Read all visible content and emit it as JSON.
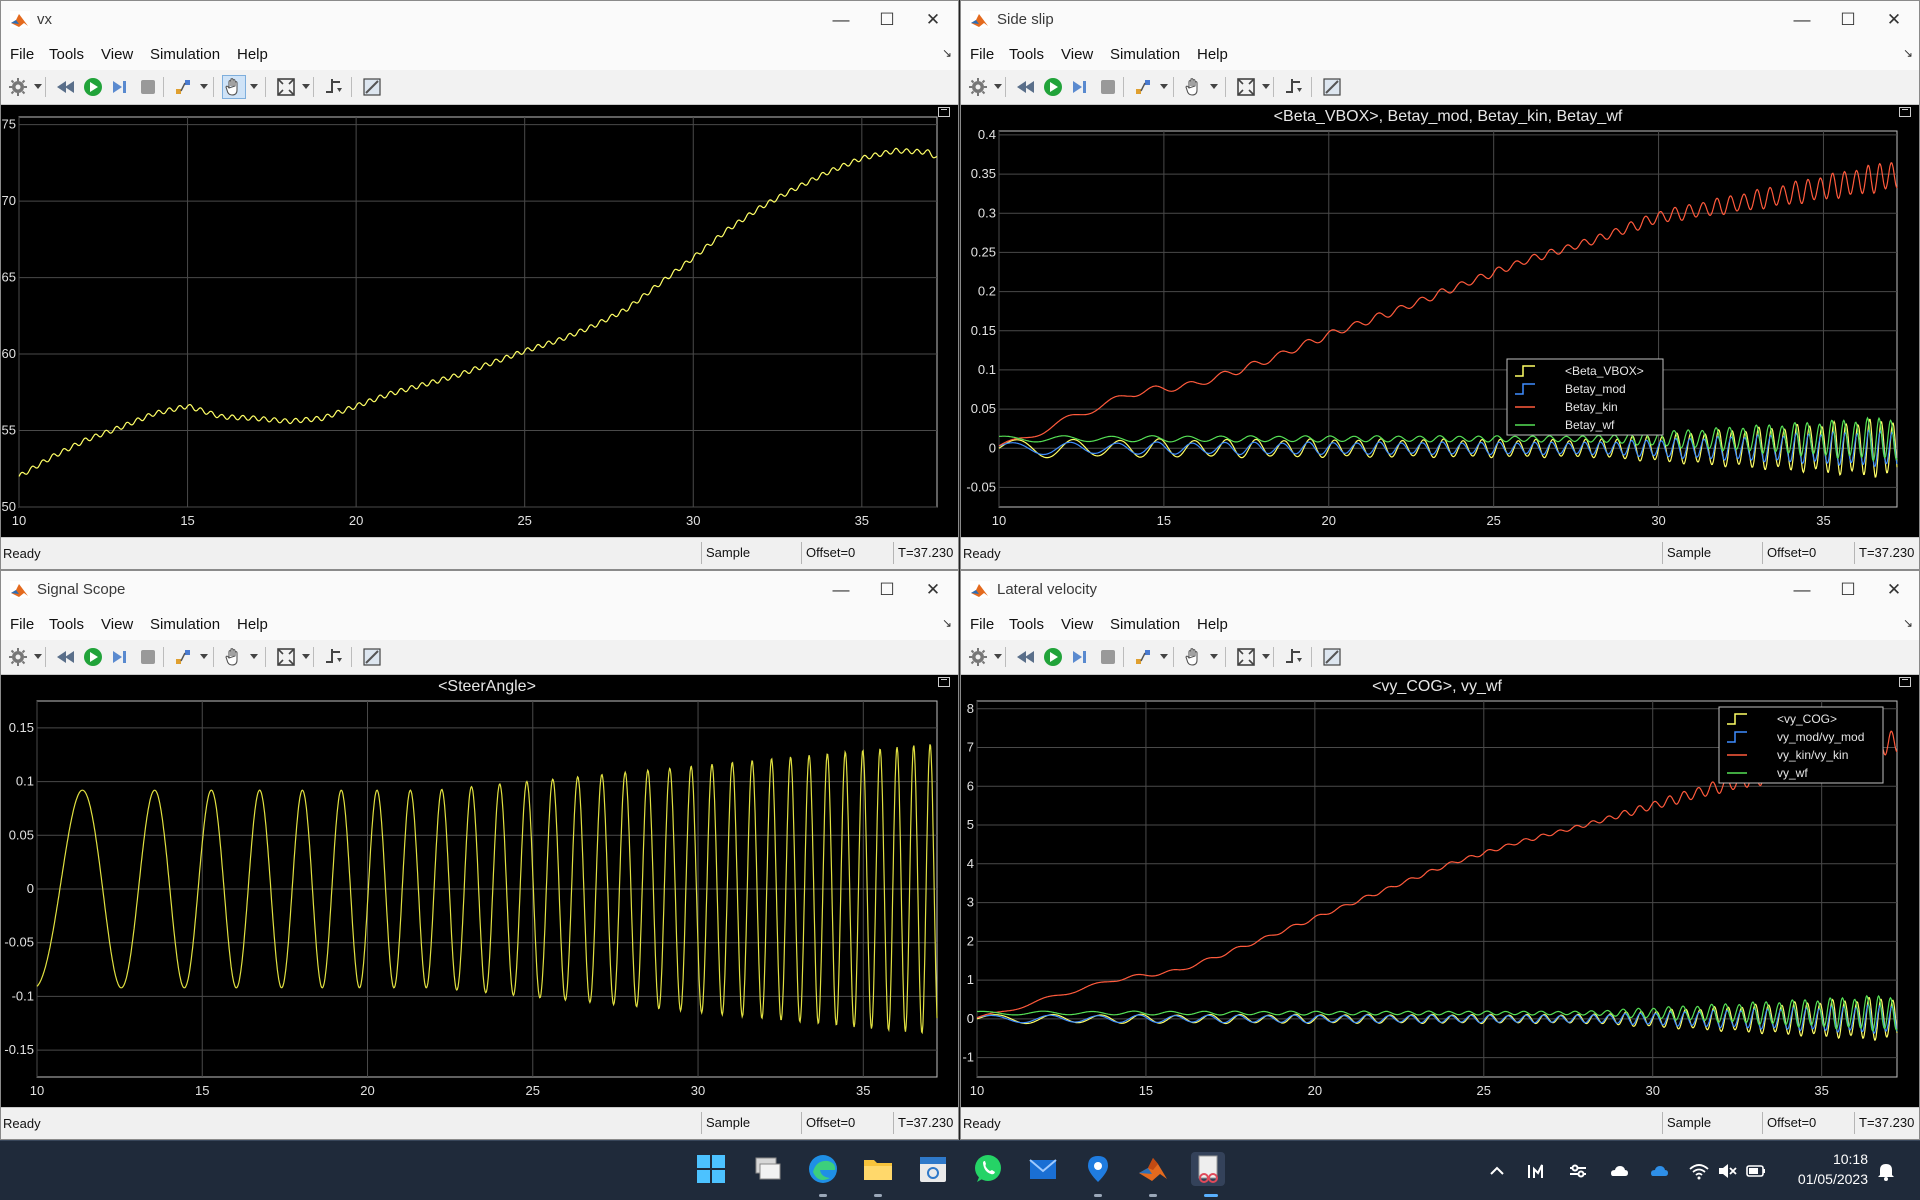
{
  "common": {
    "menu": [
      "File",
      "Tools",
      "View",
      "Simulation",
      "Help"
    ],
    "status": {
      "ready": "Ready",
      "sample": "Sample based",
      "offset": "Offset=0",
      "time": "T=37.230"
    }
  },
  "windows": [
    {
      "id": "vx",
      "title": "vx"
    },
    {
      "id": "side-slip",
      "title": "Side slip"
    },
    {
      "id": "signal-scope",
      "title": "Signal Scope"
    },
    {
      "id": "lateral-velocity",
      "title": "Lateral velocity"
    }
  ],
  "chart_data": [
    {
      "type": "line",
      "title": "",
      "xlim": [
        10,
        37.23
      ],
      "ylim": [
        50,
        75.5
      ],
      "xticks": [
        10,
        15,
        20,
        25,
        30,
        35
      ],
      "yticks": [
        50,
        55,
        60,
        65,
        70,
        75
      ],
      "grid": true,
      "series": [
        {
          "color": "#ffff66",
          "x": [
            10,
            11,
            12,
            13,
            14,
            15,
            16,
            17,
            18,
            19,
            20,
            21,
            22,
            23,
            24,
            25,
            26,
            27,
            28,
            29,
            30,
            31,
            32,
            33,
            34,
            35,
            36,
            37,
            37.23
          ],
          "y": [
            52,
            53.3,
            54.4,
            55.2,
            56.1,
            56.6,
            55.9,
            55.8,
            55.6,
            55.8,
            56.6,
            57.4,
            58.0,
            58.6,
            59.4,
            60.2,
            60.9,
            61.8,
            62.9,
            64.6,
            66.3,
            68.1,
            69.6,
            70.8,
            71.9,
            72.8,
            73.3,
            73.2,
            72.8
          ],
          "osc": 0.15
        }
      ]
    },
    {
      "type": "line",
      "title": "<Beta_VBOX>, Betay_mod, Betay_kin, Betay_wf",
      "xlim": [
        10,
        37.23
      ],
      "ylim": [
        -0.075,
        0.405
      ],
      "xticks": [
        10,
        15,
        20,
        25,
        30,
        35
      ],
      "yticks": [
        -0.05,
        0,
        0.05,
        0.1,
        0.15,
        0.2,
        0.25,
        0.3,
        0.35,
        0.4
      ],
      "grid": true,
      "legend": {
        "position": "center-right",
        "entries": [
          "<Beta_VBOX>",
          "Betay_mod",
          "Betay_kin",
          "Betay_wf"
        ]
      },
      "series": [
        {
          "name": "<Beta_VBOX>",
          "color": "#ffff66",
          "x": [
            10,
            30,
            37.23
          ],
          "y": [
            0,
            0,
            0
          ],
          "osc": 0.012,
          "osc_end": 0.04,
          "osc_freq": 1
        },
        {
          "name": "Betay_mod",
          "color": "#3f8eff",
          "x": [
            10,
            30,
            37.23
          ],
          "y": [
            0,
            0,
            0
          ],
          "osc": 0.008,
          "osc_end": 0.025,
          "osc_freq": 1
        },
        {
          "name": "Betay_kin",
          "color": "#ff5a3c",
          "x": [
            10,
            12,
            14,
            16,
            18,
            20,
            22,
            24,
            26,
            28,
            30,
            32,
            34,
            36,
            37.23
          ],
          "y": [
            0,
            0.035,
            0.07,
            0.082,
            0.11,
            0.145,
            0.175,
            0.208,
            0.24,
            0.265,
            0.295,
            0.31,
            0.325,
            0.34,
            0.35
          ],
          "osc": 0.005,
          "osc_end": 0.02,
          "osc_freq": 1
        },
        {
          "name": "Betay_wf",
          "color": "#55e055",
          "x": [
            10,
            30,
            37.23
          ],
          "y": [
            0.012,
            0.012,
            0.012
          ],
          "osc": 0.004,
          "osc_end": 0.03,
          "osc_freq": 1
        }
      ]
    },
    {
      "type": "line",
      "title": "<SteerAngle>",
      "xlim": [
        10,
        37.23
      ],
      "ylim": [
        -0.175,
        0.175
      ],
      "xticks": [
        10,
        15,
        20,
        25,
        30,
        35
      ],
      "yticks": [
        -0.15,
        -0.1,
        -0.05,
        0,
        0.05,
        0.1,
        0.15
      ],
      "grid": true,
      "series": [
        {
          "color": "#e0e040",
          "x": [
            10,
            37.23
          ],
          "y": [
            0,
            0
          ],
          "osc": 0.092,
          "osc_end": 0.135,
          "osc_freq": 1,
          "chirp": true
        }
      ]
    },
    {
      "type": "line",
      "title": "<vy_COG>, vy_wf",
      "xlim": [
        10,
        37.23
      ],
      "ylim": [
        -1.5,
        8.2
      ],
      "xticks": [
        10,
        15,
        20,
        25,
        30,
        35
      ],
      "yticks": [
        -1,
        0,
        1,
        2,
        3,
        4,
        5,
        6,
        7,
        8
      ],
      "grid": true,
      "legend": {
        "position": "top-right",
        "entries": [
          "<vy_COG>",
          "vy_mod/vy_mod",
          "vy_kin/vy_kin",
          "vy_wf"
        ]
      },
      "series": [
        {
          "name": "<vy_COG>",
          "color": "#ffff66",
          "x": [
            10,
            30,
            37.23
          ],
          "y": [
            0,
            0,
            0
          ],
          "osc": 0.12,
          "osc_end": 0.6,
          "osc_freq": 1
        },
        {
          "name": "vy_mod/vy_mod",
          "color": "#3f8eff",
          "x": [
            10,
            30,
            37.23
          ],
          "y": [
            0,
            0,
            0
          ],
          "osc": 0.1,
          "osc_end": 0.4,
          "osc_freq": 1
        },
        {
          "name": "vy_kin/vy_kin",
          "color": "#ff5a3c",
          "x": [
            10,
            12,
            14,
            16,
            18,
            20,
            22,
            24,
            26,
            28,
            30,
            32,
            34,
            36,
            37.23
          ],
          "y": [
            0,
            0.5,
            1,
            1.25,
            1.9,
            2.6,
            3.3,
            4.0,
            4.55,
            5.0,
            5.5,
            6.0,
            6.4,
            6.8,
            7.2
          ],
          "osc": 0.05,
          "osc_end": 0.35,
          "osc_freq": 1
        },
        {
          "name": "vy_wf",
          "color": "#55e055",
          "x": [
            10,
            30,
            37.23
          ],
          "y": [
            0.15,
            0.15,
            0.15
          ],
          "osc": 0.05,
          "osc_end": 0.5,
          "osc_freq": 1
        }
      ]
    }
  ],
  "taskbar": {
    "apps": [
      "start",
      "task-view",
      "edge",
      "file-explorer",
      "calendar",
      "whatsapp",
      "mail",
      "maps",
      "matlab",
      "snipping-tool"
    ],
    "time": "10:18",
    "date": "01/05/2023"
  }
}
